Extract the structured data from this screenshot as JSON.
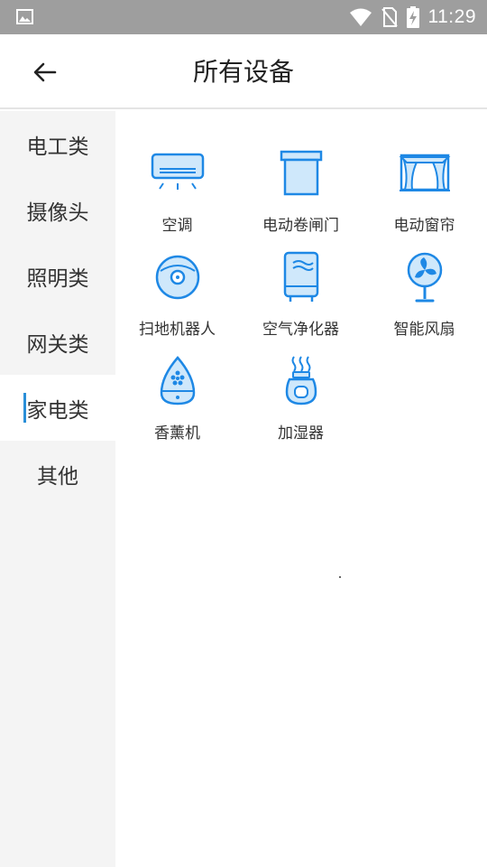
{
  "status_bar": {
    "time": "11:29"
  },
  "header": {
    "title": "所有设备"
  },
  "sidebar": {
    "items": [
      {
        "label": "电工类"
      },
      {
        "label": "摄像头"
      },
      {
        "label": "照明类"
      },
      {
        "label": "网关类"
      },
      {
        "label": "家电类",
        "active": true
      },
      {
        "label": "其他"
      }
    ]
  },
  "devices": [
    {
      "label": "空调",
      "icon": "air-conditioner-icon"
    },
    {
      "label": "电动卷闸门",
      "icon": "rolling-door-icon"
    },
    {
      "label": "电动窗帘",
      "icon": "curtain-icon"
    },
    {
      "label": "扫地机器人",
      "icon": "robot-vacuum-icon"
    },
    {
      "label": "空气净化器",
      "icon": "air-purifier-icon"
    },
    {
      "label": "智能风扇",
      "icon": "fan-icon"
    },
    {
      "label": "香薰机",
      "icon": "aroma-diffuser-icon"
    },
    {
      "label": "加湿器",
      "icon": "humidifier-icon"
    }
  ],
  "colors": {
    "accent": "#2a8fd8",
    "icon_fill": "#cfe8fb",
    "icon_stroke": "#1e88e5",
    "status_bar": "#9e9e9e"
  }
}
